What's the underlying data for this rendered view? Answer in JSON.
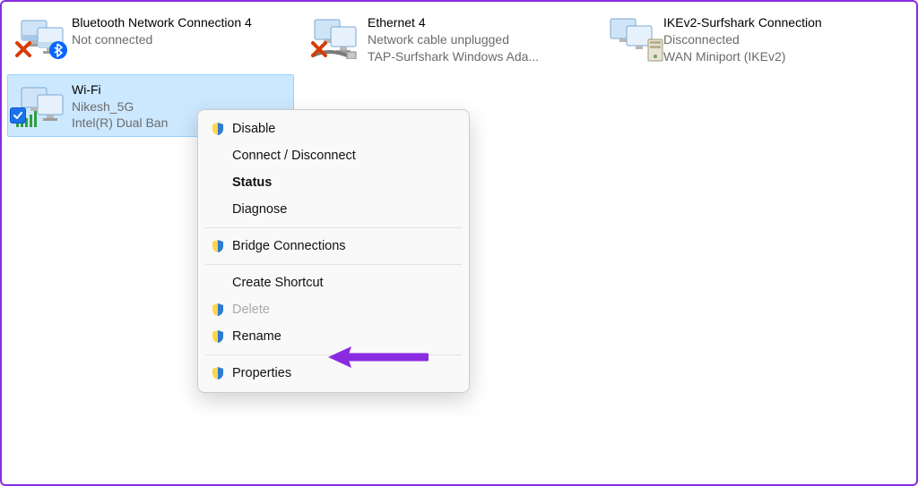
{
  "adapters": [
    {
      "name": "Bluetooth Network Connection 4",
      "status": "Not connected",
      "details": "",
      "overlay": "disabled",
      "secondary_overlay": "bluetooth"
    },
    {
      "name": "Ethernet 4",
      "status": "Network cable unplugged",
      "details": "TAP-Surfshark Windows Ada...",
      "overlay": "disabled"
    },
    {
      "name": "IKEv2-Surfshark Connection",
      "status": "Disconnected",
      "details": "WAN Miniport (IKEv2)",
      "overlay": "tower"
    },
    {
      "name": "Wi-Fi",
      "status": "Nikesh_5G",
      "details": "Intel(R) Dual Ban",
      "overlay": "wifi",
      "selected": true
    }
  ],
  "context_menu": {
    "disable": "Disable",
    "connect": "Connect / Disconnect",
    "status": "Status",
    "diagnose": "Diagnose",
    "bridge": "Bridge Connections",
    "shortcut": "Create Shortcut",
    "delete": "Delete",
    "rename": "Rename",
    "properties": "Properties"
  },
  "annotation": {
    "color": "#8a2be2"
  }
}
